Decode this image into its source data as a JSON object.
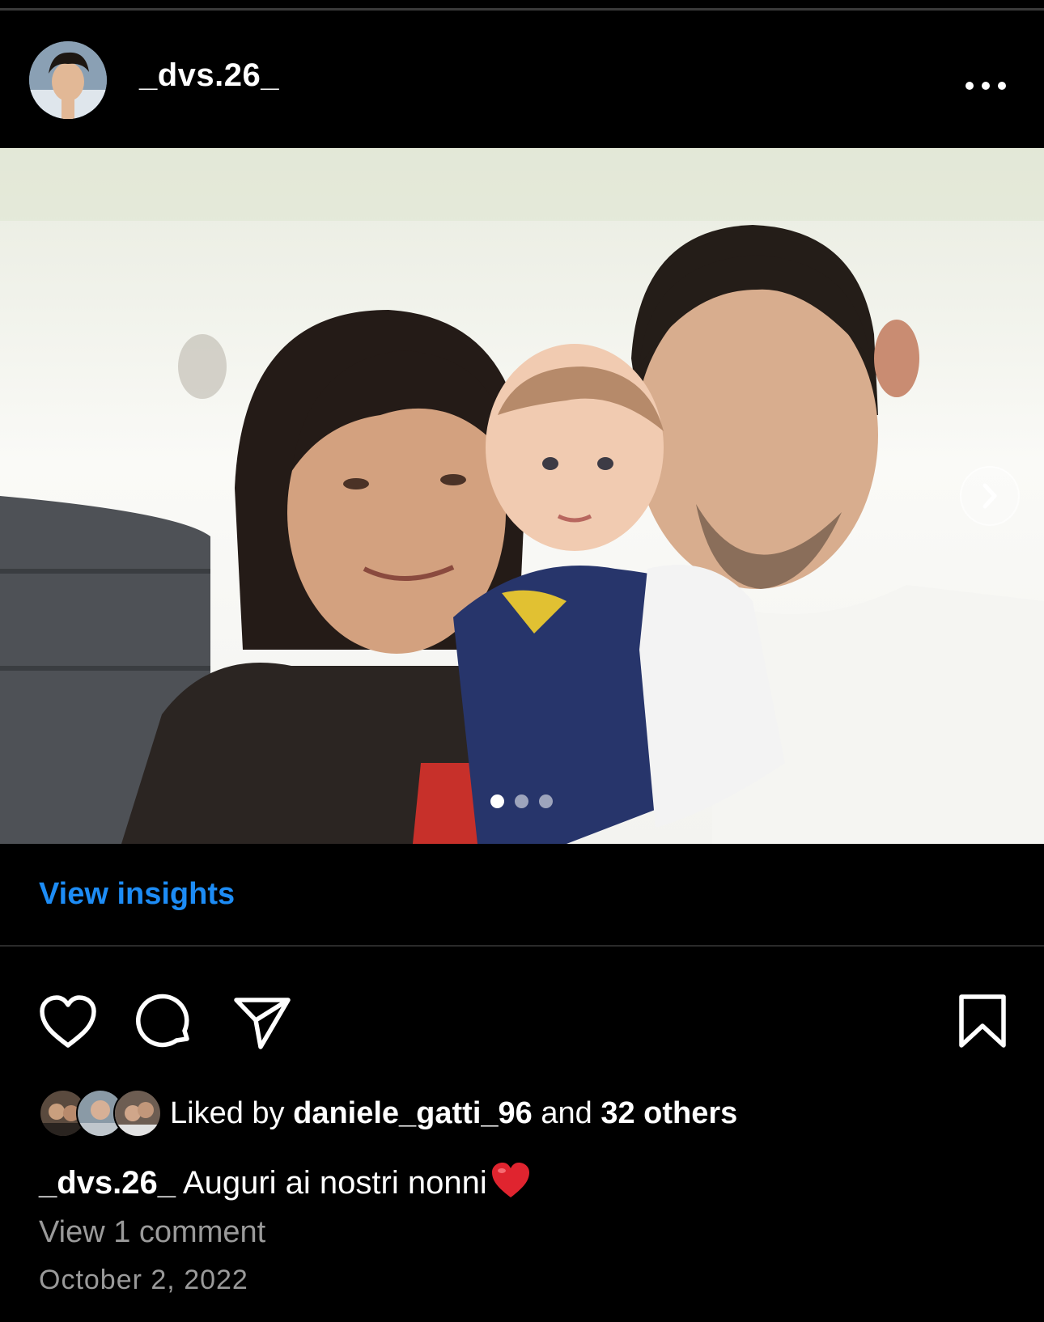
{
  "post": {
    "username": "_dvs.26_",
    "view_insights": "View insights",
    "liked_by_prefix": "Liked by",
    "liked_by_user": "daniele_gatti_96",
    "liked_by_and": "and",
    "liked_by_others": "32 others",
    "caption_user": "_dvs.26_",
    "caption_text": "Auguri ai nostri nonni",
    "view_comments": "View 1 comment",
    "date": "October 2, 2022",
    "carousel": {
      "count": 3,
      "active_index": 0
    }
  },
  "icons": {
    "more": "more-options-icon",
    "like": "heart-icon",
    "comment": "comment-icon",
    "share": "send-icon",
    "save": "bookmark-icon",
    "next": "chevron-right-icon",
    "caption_emoji": "red-heart-emoji"
  },
  "colors": {
    "background": "#000000",
    "link_blue": "#1d8cf5",
    "muted_text": "#9a9a9a",
    "emoji_heart": "#e0242f"
  }
}
